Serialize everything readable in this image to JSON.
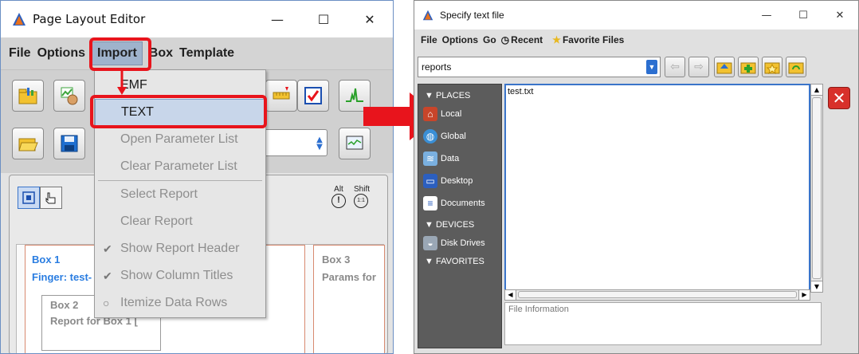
{
  "left_window": {
    "title": "Page Layout Editor",
    "controls": {
      "minimize": "—",
      "maximize": "☐",
      "close": "✕"
    },
    "menu": [
      "File",
      "Options",
      "Import",
      "Box",
      "Template"
    ],
    "import_menu": {
      "items": [
        {
          "label": "EMF",
          "enabled": true
        },
        {
          "label": "TEXT",
          "enabled": true,
          "selected": true
        },
        {
          "label": "Open Parameter List",
          "enabled": false
        },
        {
          "label": "Clear Parameter List",
          "enabled": false
        },
        {
          "label": "Select Report",
          "enabled": false
        },
        {
          "label": "Clear Report",
          "enabled": false
        },
        {
          "label": "Show Report Header",
          "enabled": false,
          "icon": "check"
        },
        {
          "label": "Show Column Titles",
          "enabled": false,
          "icon": "check"
        },
        {
          "label": "Itemize Data Rows",
          "enabled": false,
          "icon": "radio"
        }
      ]
    },
    "alt_label": "Alt",
    "shift_label": "Shift",
    "alt_icon": "!",
    "shift_icon": "1:1",
    "boxes": {
      "box1_title": "Box 1",
      "box1_sub": "Finger: test-",
      "box2_title": "Box 2",
      "box2_sub": "Report for Box 1 [",
      "box3_title": "Box 3",
      "box3_sub": "Params for"
    }
  },
  "right_window": {
    "title": "Specify text file",
    "controls": {
      "minimize": "—",
      "maximize": "☐",
      "close": "✕"
    },
    "menu": [
      "File",
      "Options",
      "Go",
      "Recent",
      "Favorite Files"
    ],
    "path": "reports",
    "places_header": "PLACES",
    "places": [
      "Local",
      "Global",
      "Data",
      "Desktop",
      "Documents"
    ],
    "devices_header": "DEVICES",
    "devices": [
      "Disk Drives"
    ],
    "favorites_header": "FAVORITES",
    "files": [
      "test.txt"
    ],
    "file_info_label": "File Information"
  },
  "colors": {
    "highlight": "#e8141c",
    "accent": "#3a74c9",
    "link_blue": "#2a7de1"
  }
}
